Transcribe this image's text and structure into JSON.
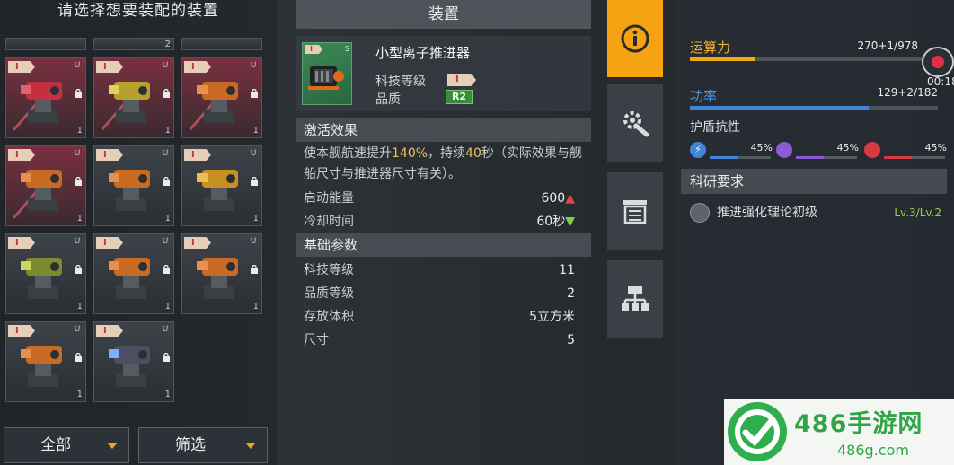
{
  "left": {
    "title": "请选择想要装配的装置",
    "filters": [
      {
        "label": "全部"
      },
      {
        "label": "筛选"
      }
    ]
  },
  "slots": [
    {
      "tier": "I",
      "u": "U",
      "count": "1",
      "art": "red-cannon",
      "selected": true
    },
    {
      "tier": "I",
      "u": "U",
      "count": "1",
      "art": "yellow-cannon",
      "selected": true
    },
    {
      "tier": "I",
      "u": "U",
      "count": "1",
      "art": "orange-cannon",
      "selected": true
    },
    {
      "tier": "I",
      "u": "U",
      "count": "1",
      "art": "orange-cannon",
      "selected": true
    },
    {
      "tier": "I",
      "u": "U",
      "count": "1",
      "art": "orange-cannon",
      "selected": false
    },
    {
      "tier": "I",
      "u": "U",
      "count": "1",
      "art": "yellow-box",
      "selected": false
    },
    {
      "tier": "I",
      "u": "U",
      "count": "1",
      "art": "yellow-turret",
      "selected": false
    },
    {
      "tier": "I",
      "u": "U",
      "count": "1",
      "art": "orange-cannon",
      "selected": false
    },
    {
      "tier": "I",
      "u": "U",
      "count": "1",
      "art": "orange-cannon",
      "selected": false
    },
    {
      "tier": "I",
      "u": "U",
      "count": "1",
      "art": "orange-cannon",
      "selected": false
    },
    {
      "tier": "I",
      "u": "U",
      "count": "1",
      "art": "blue-thruster",
      "selected": false
    }
  ],
  "partial_slots": {
    "middle": "2"
  },
  "device": {
    "header": "装置",
    "name": "小型离子推进器",
    "tier": "I",
    "slot_letter": "S",
    "tech_level_label": "科技等级",
    "quality_label": "品质",
    "quality_value": "R2",
    "activation": {
      "title": "激活效果",
      "desc_prefix": "使本舰航速提升",
      "desc_pct": "140%",
      "desc_mid": "，持续",
      "desc_dur": "40",
      "desc_suffix": "秒（实际效果与舰船尺寸与推进器尺寸有关）。",
      "rows": [
        {
          "label": "启动能量",
          "value": "600",
          "trend": "up"
        },
        {
          "label": "冷却时间",
          "value": "60秒",
          "trend": "down"
        }
      ]
    },
    "basic": {
      "title": "基础参数",
      "rows": [
        {
          "label": "科技等级",
          "value": "11"
        },
        {
          "label": "品质等级",
          "value": "2"
        },
        {
          "label": "存放体积",
          "value": "5立方米"
        },
        {
          "label": "尺寸",
          "value": "5"
        }
      ]
    }
  },
  "tabs": [
    {
      "icon": "info-icon",
      "active": true
    },
    {
      "icon": "gear-wrench-icon",
      "active": false
    },
    {
      "icon": "list-box-icon",
      "active": false
    },
    {
      "icon": "module-tree-icon",
      "active": false
    }
  ],
  "stats": {
    "compute": {
      "label": "运算力",
      "value": "270+1/978",
      "fraction": 0.28,
      "color": "#f0a812"
    },
    "power": {
      "label": "功率",
      "value": "129+2/182",
      "fraction": 0.72,
      "color": "#3f86d6"
    },
    "shield_label": "护盾抗性",
    "resist": [
      {
        "icon": "lightning-icon",
        "pct": "45%",
        "color": "#3f86d6",
        "fraction": 0.45
      },
      {
        "icon": "gravity-icon",
        "pct": "45%",
        "color": "#8b5ad6",
        "fraction": 0.45
      },
      {
        "icon": "fire-icon",
        "pct": "45%",
        "color": "#d63a44",
        "fraction": 0.45
      }
    ],
    "requirements_title": "科研要求",
    "requirement": {
      "label": "推进强化理论初级",
      "level": "Lv.3/Lv.2"
    },
    "timer": "00:18"
  },
  "watermark": {
    "title": "486手游网",
    "sub": "486g.com"
  }
}
